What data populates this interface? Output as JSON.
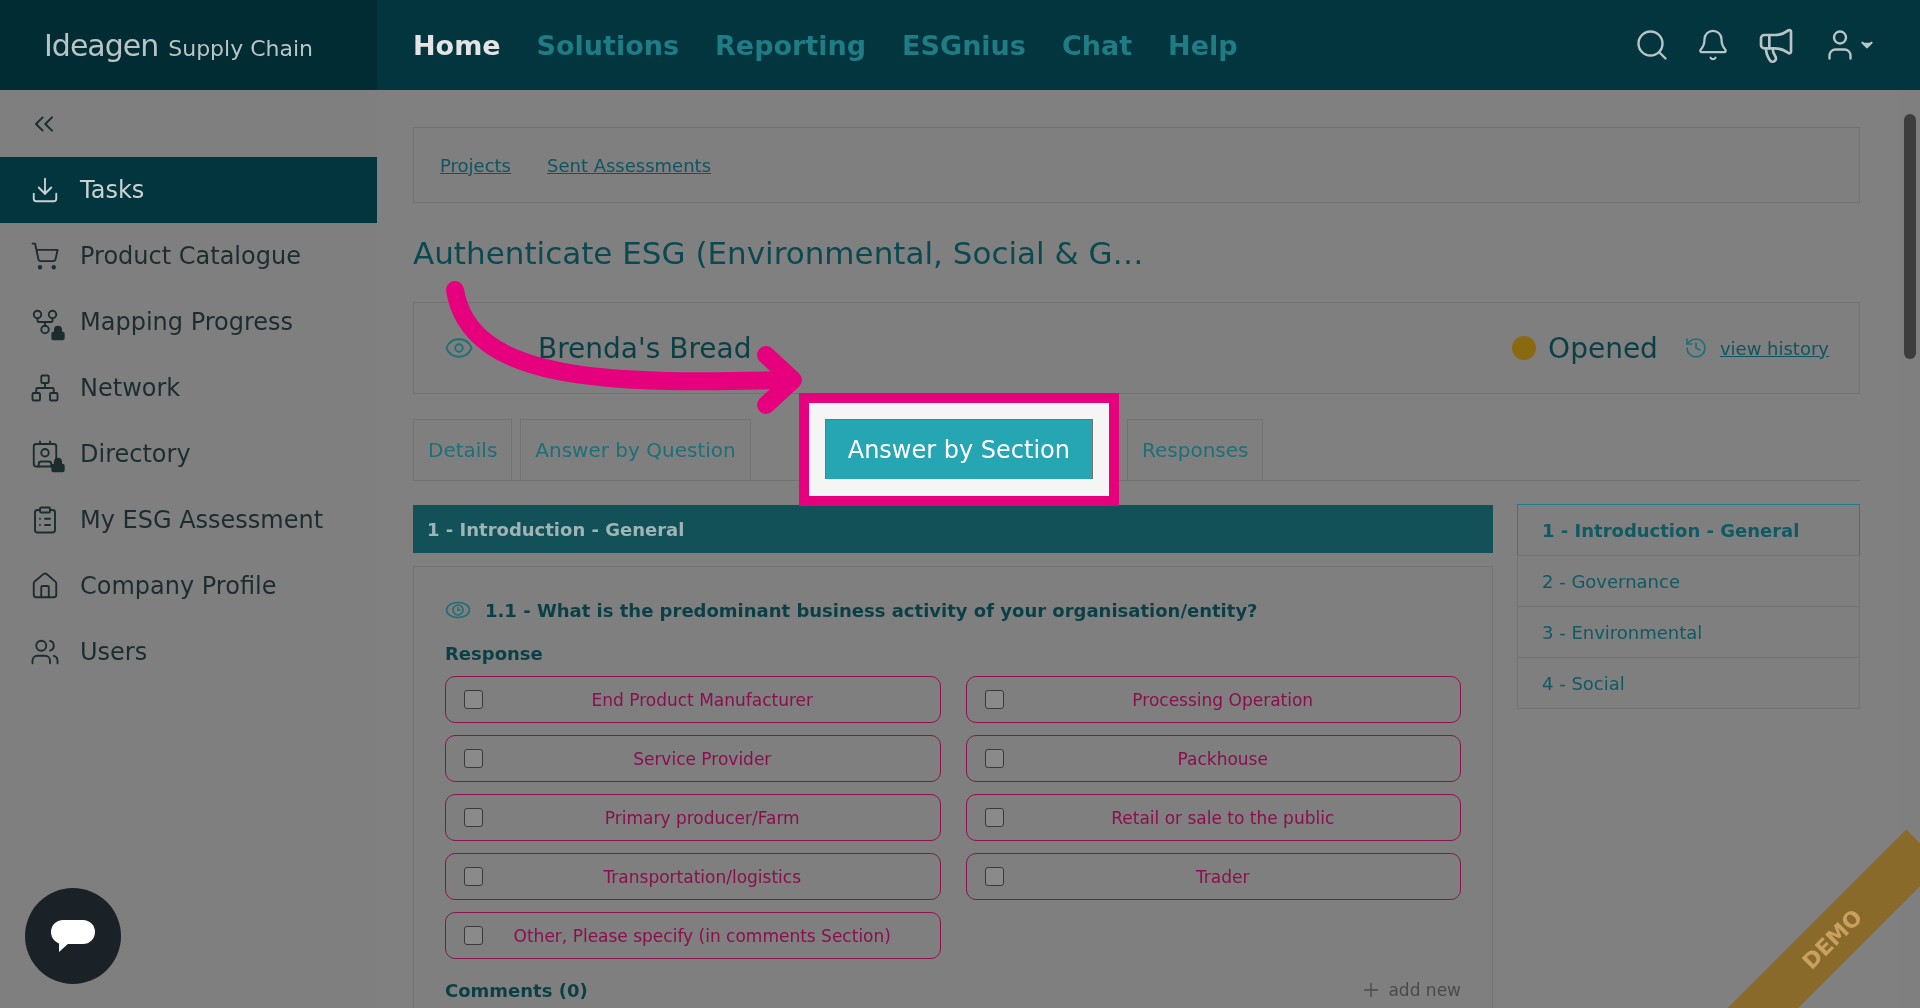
{
  "header": {
    "logo": {
      "brand": "Ideagen",
      "product": "Supply Chain"
    },
    "nav": [
      {
        "label": "Home",
        "selected": true
      },
      {
        "label": "Solutions",
        "selected": false
      },
      {
        "label": "Reporting",
        "selected": false
      },
      {
        "label": "ESGnius",
        "selected": false
      },
      {
        "label": "Chat",
        "selected": false
      },
      {
        "label": "Help",
        "selected": false
      }
    ]
  },
  "sidebar": {
    "items": [
      {
        "label": "Tasks",
        "selected": true
      },
      {
        "label": "Product Catalogue",
        "selected": false
      },
      {
        "label": "Mapping Progress",
        "selected": false
      },
      {
        "label": "Network",
        "selected": false
      },
      {
        "label": "Directory",
        "selected": false
      },
      {
        "label": "My ESG Assessment",
        "selected": false
      },
      {
        "label": "Company Profile",
        "selected": false
      },
      {
        "label": "Users",
        "selected": false
      }
    ]
  },
  "breadcrumbs": [
    "Projects",
    "Sent Assessments"
  ],
  "title": "Authenticate ESG (Environmental, Social & G…",
  "company": {
    "name": "Brenda's Bread",
    "status": "Opened",
    "history_link": "view history"
  },
  "tabs": [
    {
      "label": "Details",
      "selected": false
    },
    {
      "label": "Answer by Question",
      "selected": false
    },
    {
      "label": "Answer by Section",
      "selected": true
    },
    {
      "label": "Responses",
      "selected": false
    }
  ],
  "section": {
    "title": "1 - Introduction - General",
    "question": "1.1 - What is the predominant business activity of your organisation/entity?",
    "response_label": "Response",
    "options": [
      {
        "label": "End Product Manufacturer",
        "checked": false
      },
      {
        "label": "Processing Operation",
        "checked": false
      },
      {
        "label": "Service Provider",
        "checked": false
      },
      {
        "label": "Packhouse",
        "checked": false
      },
      {
        "label": "Primary producer/Farm",
        "checked": false
      },
      {
        "label": "Retail or sale to the public",
        "checked": false
      },
      {
        "label": "Transportation/logistics",
        "checked": false
      },
      {
        "label": "Trader",
        "checked": false
      },
      {
        "label": "Other, Please specify (in comments Section)",
        "checked": false
      }
    ],
    "comments_label": "Comments (0)",
    "add_new": "add new"
  },
  "section_nav": [
    {
      "label": "1 - Introduction - General",
      "selected": true
    },
    {
      "label": "2 - Governance",
      "selected": false
    },
    {
      "label": "3 - Environmental",
      "selected": false
    },
    {
      "label": "4 - Social",
      "selected": false
    }
  ],
  "demo_ribbon": "DEMO"
}
